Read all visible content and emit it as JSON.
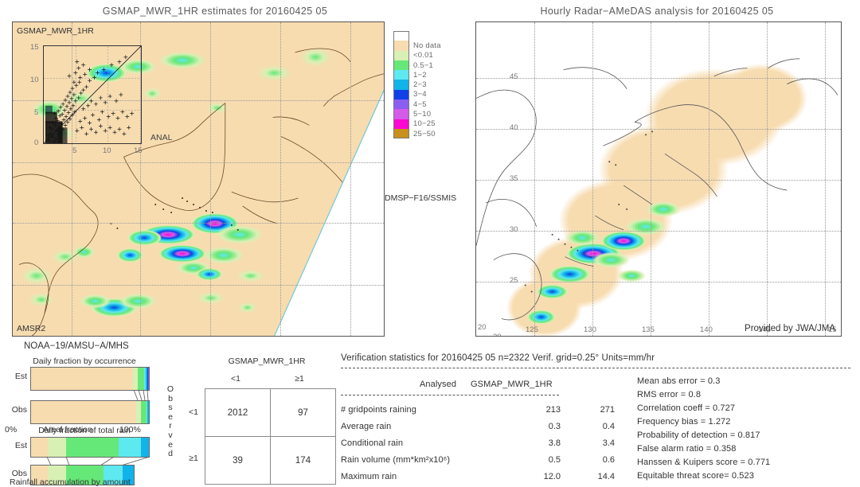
{
  "left_panel": {
    "title": "GSMAP_MWR_1HR estimates for 20160425 05",
    "tag_topleft": "GSMAP_MWR_1HR",
    "tag_bottomleft": "AMSR2",
    "label_anal": "ANAL",
    "label_swath": "DMSP−F16/SSMIS",
    "inset": {
      "y_ticks": [
        "15",
        "10",
        "5",
        "0"
      ],
      "x_ticks": [
        "5",
        "10",
        "15"
      ]
    }
  },
  "right_panel": {
    "title": "Hourly Radar−AMeDAS analysis for 20160425 05",
    "credit": "Provided by JWA/JMA",
    "x_ticks": [
      "120",
      "125",
      "130",
      "135",
      "140",
      "145",
      "15"
    ],
    "y_ticks": [
      "45",
      "40",
      "35",
      "30",
      "25",
      "20"
    ],
    "corner_lat": "20"
  },
  "colorbar": {
    "entries": [
      {
        "label": "",
        "color": "#ffffff"
      },
      {
        "label": "No data",
        "color": "#f7dcb0"
      },
      {
        "label": "<0.01",
        "color": "#d8f0b4"
      },
      {
        "label": "0.5−1",
        "color": "#66e878"
      },
      {
        "label": "1−2",
        "color": "#5ee8f0"
      },
      {
        "label": "2−3",
        "color": "#10b4e8"
      },
      {
        "label": "3−4",
        "color": "#1040e8"
      },
      {
        "label": "4−5",
        "color": "#8a5ef0"
      },
      {
        "label": "5−10",
        "color": "#d45ae8"
      },
      {
        "label": "10−25",
        "color": "#fa08d0"
      },
      {
        "label": "25−50",
        "color": "#c8901c"
      }
    ]
  },
  "sensors_label": "NOAA−19/AMSU−A/MHS",
  "fraction_occurrence": {
    "title": "Daily fraction by occurrence",
    "axis_left": "0%",
    "axis_center": "Areal fraction",
    "axis_right": "100%",
    "rows": [
      {
        "label": "Est",
        "segments": [
          {
            "color": "#f7dcb0",
            "pct": 86.5
          },
          {
            "color": "#d8f0b4",
            "pct": 4.0
          },
          {
            "color": "#66e878",
            "pct": 5.5
          },
          {
            "color": "#5ee8f0",
            "pct": 1.6
          },
          {
            "color": "#10b4e8",
            "pct": 1.0
          },
          {
            "color": "#1040e8",
            "pct": 0.7
          },
          {
            "color": "#8a5ef0",
            "pct": 0.7
          }
        ]
      },
      {
        "label": "Obs",
        "segments": [
          {
            "color": "#f7dcb0",
            "pct": 89.5
          },
          {
            "color": "#d8f0b4",
            "pct": 3.5
          },
          {
            "color": "#66e878",
            "pct": 5.0
          },
          {
            "color": "#5ee8f0",
            "pct": 1.0
          },
          {
            "color": "#10b4e8",
            "pct": 1.0
          }
        ]
      }
    ]
  },
  "fraction_total_rain": {
    "title": "Daily fraction of total rain",
    "axis_bottom": "Rainfall accumulation by amount",
    "rows": [
      {
        "label": "Est",
        "segments": [
          {
            "color": "#f7dcb0",
            "pct": 14.0
          },
          {
            "color": "#d8f0b4",
            "pct": 16.0
          },
          {
            "color": "#66e878",
            "pct": 44.0
          },
          {
            "color": "#5ee8f0",
            "pct": 19.0
          },
          {
            "color": "#10b4e8",
            "pct": 7.0
          }
        ]
      },
      {
        "label": "Obs",
        "segments": [
          {
            "color": "#f7dcb0",
            "pct": 14.0
          },
          {
            "color": "#d8f0b4",
            "pct": 16.0
          },
          {
            "color": "#66e878",
            "pct": 32.0
          },
          {
            "color": "#5ee8f0",
            "pct": 19.0
          },
          {
            "color": "#10b4e8",
            "pct": 13.0
          }
        ]
      }
    ]
  },
  "contingency": {
    "title": "GSMAP_MWR_1HR",
    "col_headers": [
      "<1",
      "≥1"
    ],
    "row_headers": [
      "<1",
      "≥1"
    ],
    "side_label": "Observed",
    "cells": [
      [
        "2012",
        "97"
      ],
      [
        "39",
        "174"
      ]
    ]
  },
  "verification": {
    "header": "Verification statistics for 20160425 05   n=2322   Verif. grid=0.25°   Units=mm/hr",
    "col_analysed": "Analysed",
    "col_model": "GSMAP_MWR_1HR",
    "rows": [
      {
        "name": "# gridpoints raining",
        "analysed": "213",
        "model": "271"
      },
      {
        "name": "Average rain",
        "analysed": "0.3",
        "model": "0.4"
      },
      {
        "name": "Conditional rain",
        "analysed": "3.8",
        "model": "3.4"
      },
      {
        "name": "Rain volume (mm*km²x10⁶)",
        "analysed": "0.5",
        "model": "0.6"
      },
      {
        "name": "Maximum rain",
        "analysed": "12.0",
        "model": "14.4"
      }
    ],
    "scores": [
      "Mean abs error = 0.3",
      "RMS error = 0.8",
      "Correlation coeff = 0.727",
      "Frequency bias = 1.272",
      "Probability of detection = 0.817",
      "False alarm ratio = 0.358",
      "Hanssen & Kuipers score = 0.771",
      "Equitable threat score= 0.523"
    ]
  }
}
